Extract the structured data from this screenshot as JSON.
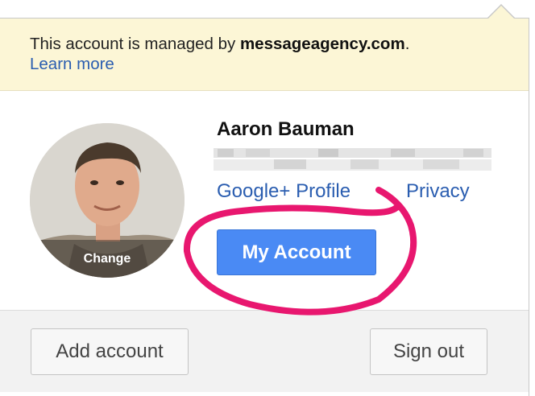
{
  "notice": {
    "text_prefix": "This account is managed by ",
    "domain": "messageagency.com",
    "text_suffix": ".",
    "learn_more": "Learn more"
  },
  "profile": {
    "name": "Aaron Bauman",
    "change_label": "Change",
    "links": {
      "google_plus": "Google+ Profile",
      "privacy": "Privacy"
    },
    "my_account_label": "My Account"
  },
  "footer": {
    "add_account_label": "Add account",
    "sign_out_label": "Sign out"
  },
  "colors": {
    "notice_bg": "#fcf6d6",
    "link": "#2a5db0",
    "primary_button": "#4a8af4",
    "annotation": "#e8176f"
  }
}
